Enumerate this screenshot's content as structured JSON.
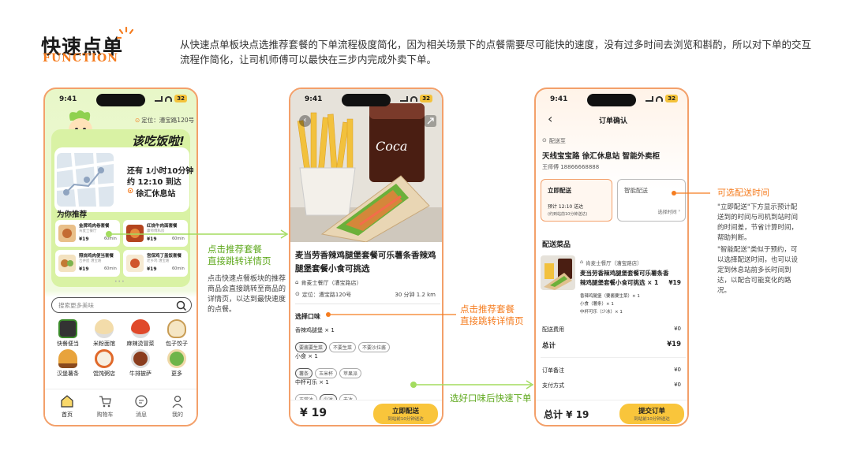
{
  "header": {
    "title": "快速点单",
    "subtitle": "FUNCTION",
    "description": "从快速点单板块点选推荐套餐的下单流程极度简化，因为相关场景下的点餐需要尽可能快的速度，没有过多时间去浏览和斟酌，所以对下单的交互流程作简化，让司机师傅可以最快在三步内完成外卖下单。"
  },
  "status": {
    "time": "9:41",
    "battery": "32"
  },
  "phone1": {
    "location_label": "定位：漕宝路120号",
    "banner_text": "该吃饭啦!",
    "remain_label": "还有 1小时10分钟",
    "arrive_label": "约 12:10 到达",
    "station": "徐汇休息站",
    "recommend_title": "为你推荐",
    "recommends": [
      {
        "name": "金牌鸡肉卷套餐",
        "tag": "肯麦士餐厅",
        "price": "¥19",
        "time": "60min"
      },
      {
        "name": "红烧牛肉面套餐",
        "tag": "康师傅私房",
        "price": "¥19",
        "time": "60min"
      },
      {
        "name": "照烧鸡肉便当套餐",
        "tag": "吉井屋 漕宝路",
        "price": "¥19",
        "time": "60min"
      },
      {
        "name": "宫保鸡丁盖饭套餐",
        "tag": "老乡鸡 漕宝路",
        "price": "¥19",
        "time": "60min"
      }
    ],
    "search_placeholder": "搜索更多美味",
    "categories": [
      "快餐便当",
      "米粉面馆",
      "麻辣烫冒菜",
      "包子饺子",
      "汉堡薯条",
      "馄饨粥店",
      "牛排披萨",
      "更多"
    ],
    "nav": [
      "首页",
      "购物车",
      "消息",
      "我的"
    ]
  },
  "phone2": {
    "title": "麦当劳香辣鸡腿堡套餐可乐薯条香辣鸡腿堡套餐小食可挑选",
    "shop": "肯麦士餐厅（漕宝路店）",
    "location": "定位：漕宝路120号",
    "eta": "30 分钟  1.2 km",
    "select_title": "选择口味",
    "groups": [
      {
        "name": "香辣鸡腿堡 × 1",
        "options": [
          "要酱要生菜",
          "不要生菜",
          "不要沙拉酱"
        ]
      },
      {
        "name": "小食 × 1",
        "options": [
          "薯条",
          "玉米杯",
          "苹果派"
        ]
      },
      {
        "name": "中杯可乐 × 1",
        "options": [
          "正常冰",
          "少冰",
          "去冰"
        ]
      }
    ],
    "price": "¥ 19",
    "button": "立即配送",
    "button_sub": "到站前10分钟送达"
  },
  "phone3": {
    "nav_title": "订单确认",
    "deliver_to": "配送至",
    "address": "天线宝宝路 徐汇休息站 智能外卖柜",
    "contact": "王师傅  18866668888",
    "opt1_title": "立即配送",
    "opt1_line1": "预计 12:10 送达",
    "opt1_line2": "(约到站前10分钟送达)",
    "opt2_title": "智能配送",
    "opt2_select": "选择时间",
    "items_title": "配送菜品",
    "shop": "肯麦士餐厅（漕宝路店）",
    "item_name": "麦当劳香辣鸡腿堡套餐可乐薯条香辣鸡腿堡套餐小食可挑选 × 1",
    "item_price": "¥19",
    "item_subs": [
      "香辣鸡腿堡（要酱要生菜）× 1",
      "小食（薯条）× 1",
      "中杯可乐（少冰）× 1"
    ],
    "fee_label": "配送费用",
    "fee_value": "¥0",
    "total_label": "总计",
    "total_value": "¥19",
    "note_label": "订单备注",
    "note_value": "¥0",
    "pay_label": "支付方式",
    "pay_value": "¥0",
    "bottom_total": "总计 ¥ 19",
    "submit": "提交订单",
    "submit_sub": "到站前10分钟送达"
  },
  "annotations": {
    "a1_title": "点击推荐套餐\n直接跳转详情页",
    "a1_desc": "点击快速点餐板块的推荐商品会直接跳转至商品的详情页，以达到最快速度的点餐。",
    "a2_title": "点击推荐套餐\n直接跳转详情页",
    "a3_title": "选好口味后快速下单",
    "a4_title": "可选配送时间",
    "a4_desc1": "\"立即配送\"下方显示预计配送到的时间与司机到站时间的时间差，节省计算时间，帮助判断。",
    "a4_desc2": "\"智能配送\"类似于预约，可以选择配送时间，也可以设定到休息站前多长时间到达，以配合可能变化的路况。"
  },
  "colors": {
    "accent": "#f57c1f",
    "green": "#8fd14f",
    "yellow": "#f9c53b",
    "phone_border": "#f3a06a"
  }
}
